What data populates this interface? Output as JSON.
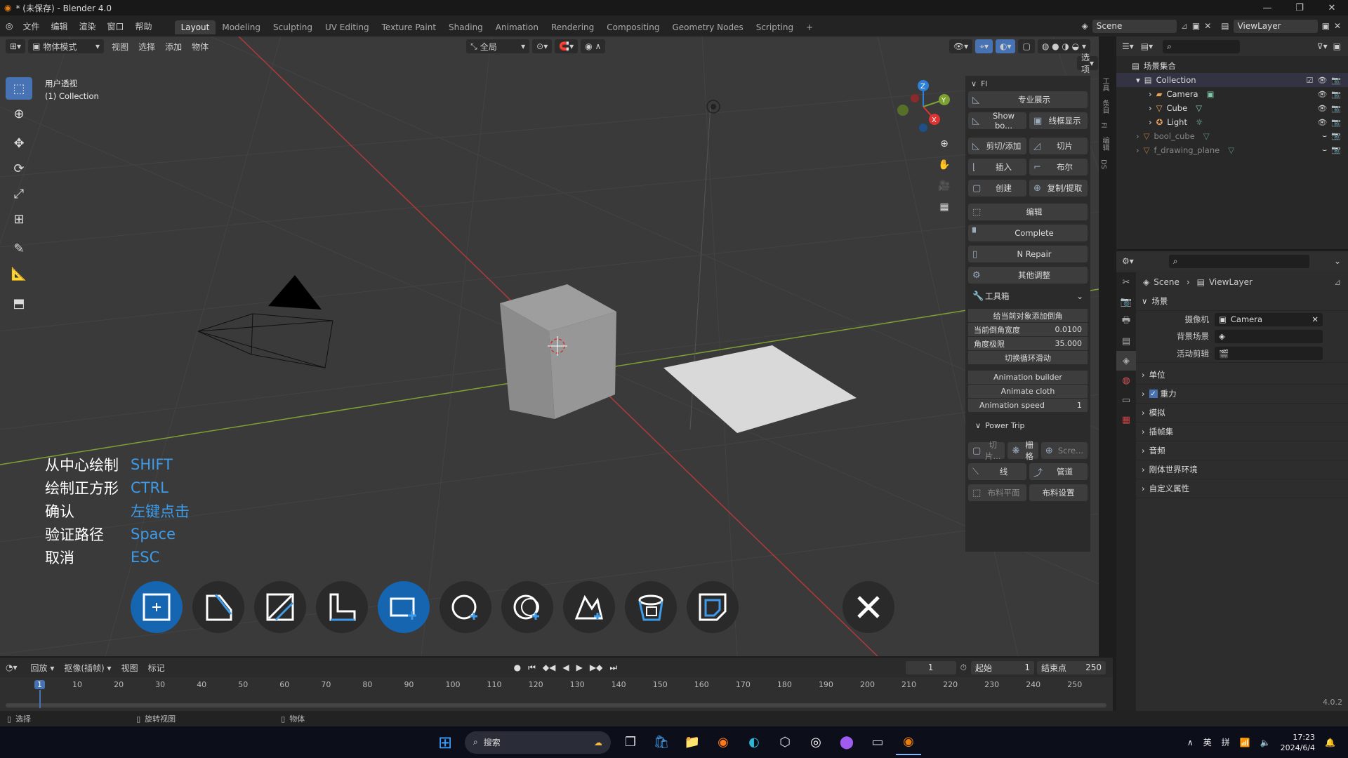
{
  "titlebar": {
    "title": "* (未保存) - Blender 4.0",
    "win_min": "—",
    "win_max": "❐",
    "win_close": "✕"
  },
  "menu": [
    "文件",
    "编辑",
    "渲染",
    "窗口",
    "帮助"
  ],
  "workspaces": [
    "Layout",
    "Modeling",
    "Sculpting",
    "UV Editing",
    "Texture Paint",
    "Shading",
    "Animation",
    "Rendering",
    "Compositing",
    "Geometry Nodes",
    "Scripting"
  ],
  "add_workspace": "+",
  "scene_field": "Scene",
  "viewlayer_field": "ViewLayer",
  "viewport": {
    "mode": "物体模式",
    "menus": [
      "视图",
      "选择",
      "添加",
      "物体"
    ],
    "orientation": "全局",
    "options_label": "选项",
    "view_name": "用户透视",
    "collection_label": "(1) Collection"
  },
  "gizmo": {
    "x": "X",
    "y": "Y",
    "z": "Z"
  },
  "npanel": {
    "header": "Fl",
    "btn_pro": "专业展示",
    "btn_showbo": "Show bo...",
    "btn_wire": "线框显示",
    "btn_cutadd": "剪切/添加",
    "btn_slice": "切片",
    "btn_insert": "插入",
    "btn_bool": "布尔",
    "btn_create": "创建",
    "btn_copy": "复制/提取",
    "btn_edit": "编辑",
    "btn_complete": "Complete",
    "btn_nrepair": "N Repair",
    "btn_other": "其他调整",
    "toolbox": "工具箱",
    "add_bevel": "给当前对象添加倒角",
    "bevel_width_label": "当前倒角宽度",
    "bevel_width_value": "0.0100",
    "angle_label": "角度极限",
    "angle_value": "35.000",
    "toggle_loop": "切换循环滑动",
    "anim_builder": "Animation builder",
    "anim_cloth": "Animate cloth",
    "anim_speed_label": "Animation speed",
    "anim_speed_value": "1",
    "power_trip": "Power Trip",
    "pt_slice": "切片...",
    "pt_grid": "栅格",
    "pt_scre": "Scre...",
    "pt_line": "线",
    "pt_pipe": "管道",
    "pt_clothplane": "布料平面",
    "pt_clothset": "布料设置"
  },
  "side_tabs": [
    "工具",
    "条目",
    "Fl",
    "编辑",
    "DS"
  ],
  "hints": [
    {
      "k": "从中心绘制",
      "v": "SHIFT"
    },
    {
      "k": "绘制正方形",
      "v": "CTRL"
    },
    {
      "k": "确认",
      "v": "左键点击"
    },
    {
      "k": "验证路径",
      "v": "Space"
    },
    {
      "k": "取消",
      "v": "ESC"
    }
  ],
  "outliner": {
    "root": "场景集合",
    "collection": "Collection",
    "items": [
      "Camera",
      "Cube",
      "Light"
    ],
    "extra": [
      "bool_cube",
      "f_drawing_plane"
    ]
  },
  "properties": {
    "breadcrumb_scene": "Scene",
    "breadcrumb_vl": "ViewLayer",
    "section": "场景",
    "camera_label": "摄像机",
    "camera_value": "Camera",
    "bg_label": "背景场景",
    "clip_label": "活动剪辑",
    "panels": [
      "单位",
      "重力",
      "模拟",
      "插帧集",
      "音频",
      "刚体世界环境",
      "自定义属性"
    ]
  },
  "timeline": {
    "menus": [
      "回放",
      "抠像(插帧)",
      "视图",
      "标记"
    ],
    "current_frame": "1",
    "start_label": "起始",
    "start_value": "1",
    "end_label": "结束点",
    "end_value": "250",
    "ticks": [
      "1",
      "10",
      "20",
      "30",
      "40",
      "50",
      "60",
      "70",
      "80",
      "90",
      "100",
      "110",
      "120",
      "130",
      "140",
      "150",
      "160",
      "170",
      "180",
      "190",
      "200",
      "210",
      "220",
      "230",
      "240",
      "250"
    ]
  },
  "status": {
    "select": "选择",
    "rotate": "旋转视图",
    "object": "物体",
    "version": "4.0.2"
  },
  "taskbar": {
    "search": "搜索",
    "lang1": "英",
    "lang2": "拼",
    "time": "17:23",
    "date": "2024/6/4"
  }
}
